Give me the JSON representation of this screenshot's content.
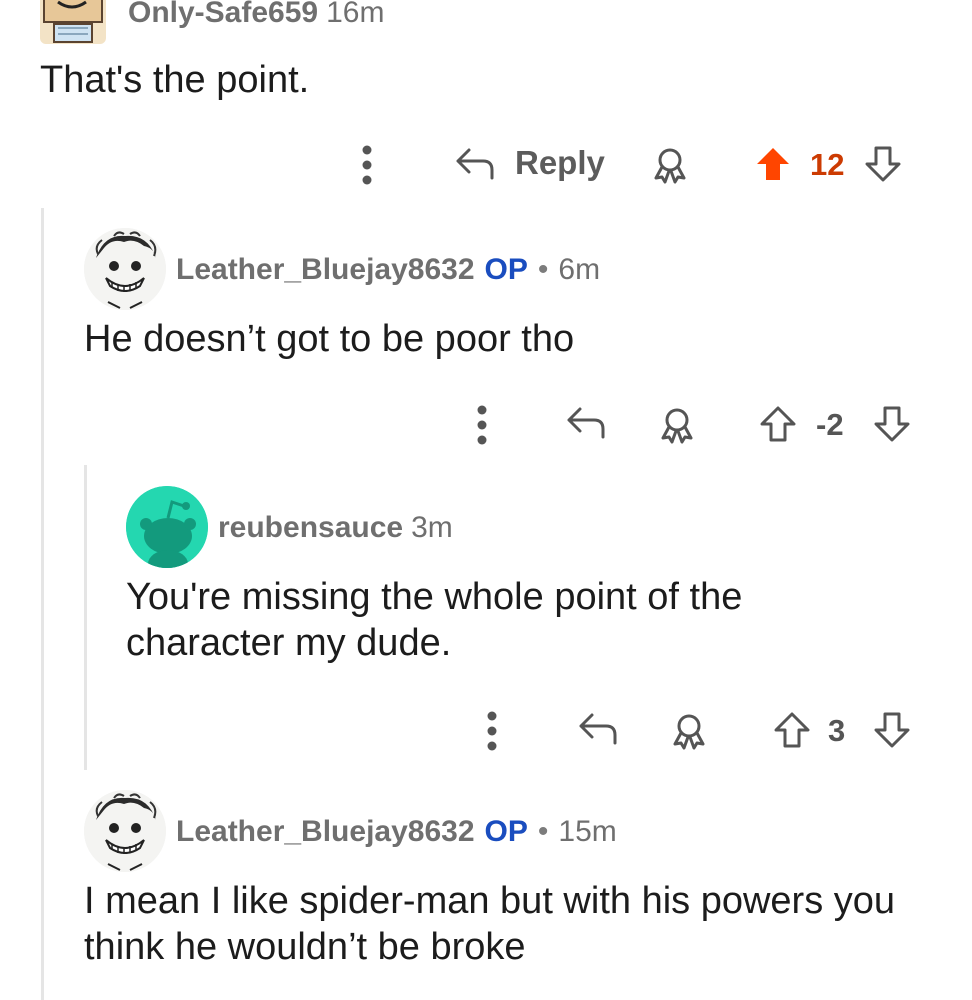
{
  "comments": [
    {
      "username": "Only-Safe659",
      "op_label": "",
      "time": "16m",
      "body": "That's the point.",
      "reply_label": "Reply",
      "score": "12",
      "upvoted": true,
      "accent_color": "#ff4500"
    },
    {
      "username": "Leather_Bluejay8632",
      "op_label": "OP",
      "separator": "•",
      "time": "6m",
      "body": "He doesn’t got to be poor tho",
      "score": "-2"
    },
    {
      "username": "reubensauce",
      "time": "3m",
      "body_line1": "You're missing the whole point of the",
      "body_line2": "character my dude.",
      "score": "3",
      "avatar_color": "#24d7b0"
    },
    {
      "username": "Leather_Bluejay8632",
      "op_label": "OP",
      "separator": "•",
      "time": "15m",
      "body_line1": "I mean I like spider-man but with his powers you",
      "body_line2": "think he wouldn’t be broke"
    }
  ]
}
